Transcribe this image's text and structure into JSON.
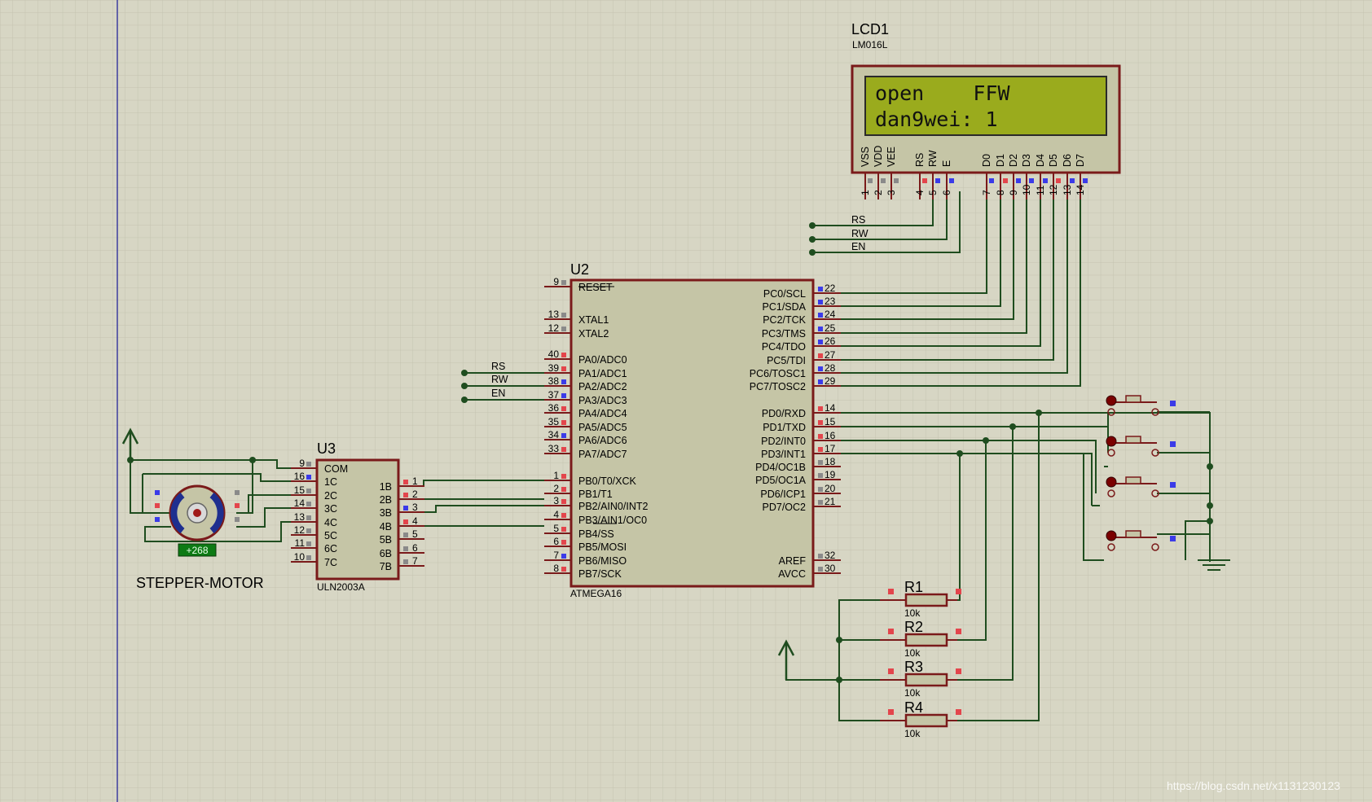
{
  "lcd": {
    "ref": "LCD1",
    "part": "LM016L",
    "line1": "open    FFW",
    "line2": "dan9wei: 1",
    "pin_names": [
      "VSS",
      "VDD",
      "VEE",
      "RS",
      "RW",
      "E",
      "D0",
      "D1",
      "D2",
      "D3",
      "D4",
      "D5",
      "D6",
      "D7"
    ],
    "pin_numbers": [
      "1",
      "2",
      "3",
      "4",
      "5",
      "6",
      "7",
      "8",
      "9",
      "10",
      "11",
      "12",
      "13",
      "14"
    ],
    "net_labels": [
      "RS",
      "RW",
      "EN"
    ]
  },
  "mcu": {
    "ref": "U2",
    "part": "ATMEGA16",
    "left_pins": [
      {
        "num": "9",
        "name": "RESET"
      },
      {
        "num": "13",
        "name": "XTAL1"
      },
      {
        "num": "12",
        "name": "XTAL2"
      },
      {
        "num": "40",
        "name": "PA0/ADC0"
      },
      {
        "num": "39",
        "name": "PA1/ADC1"
      },
      {
        "num": "38",
        "name": "PA2/ADC2"
      },
      {
        "num": "37",
        "name": "PA3/ADC3"
      },
      {
        "num": "36",
        "name": "PA4/ADC4"
      },
      {
        "num": "35",
        "name": "PA5/ADC5"
      },
      {
        "num": "34",
        "name": "PA6/ADC6"
      },
      {
        "num": "33",
        "name": "PA7/ADC7"
      },
      {
        "num": "1",
        "name": "PB0/T0/XCK"
      },
      {
        "num": "2",
        "name": "PB1/T1"
      },
      {
        "num": "3",
        "name": "PB2/AIN0/INT2"
      },
      {
        "num": "4",
        "name": "PB3/AIN1/OC0"
      },
      {
        "num": "5",
        "name": "PB4/SS"
      },
      {
        "num": "6",
        "name": "PB5/MOSI"
      },
      {
        "num": "7",
        "name": "PB6/MISO"
      },
      {
        "num": "8",
        "name": "PB7/SCK"
      }
    ],
    "right_pins": [
      {
        "num": "22",
        "name": "PC0/SCL"
      },
      {
        "num": "23",
        "name": "PC1/SDA"
      },
      {
        "num": "24",
        "name": "PC2/TCK"
      },
      {
        "num": "25",
        "name": "PC3/TMS"
      },
      {
        "num": "26",
        "name": "PC4/TDO"
      },
      {
        "num": "27",
        "name": "PC5/TDI"
      },
      {
        "num": "28",
        "name": "PC6/TOSC1"
      },
      {
        "num": "29",
        "name": "PC7/TOSC2"
      },
      {
        "num": "14",
        "name": "PD0/RXD"
      },
      {
        "num": "15",
        "name": "PD1/TXD"
      },
      {
        "num": "16",
        "name": "PD2/INT0"
      },
      {
        "num": "17",
        "name": "PD3/INT1"
      },
      {
        "num": "18",
        "name": "PD4/OC1B"
      },
      {
        "num": "19",
        "name": "PD5/OC1A"
      },
      {
        "num": "20",
        "name": "PD6/ICP1"
      },
      {
        "num": "21",
        "name": "PD7/OC2"
      },
      {
        "num": "32",
        "name": "AREF"
      },
      {
        "num": "30",
        "name": "AVCC"
      }
    ],
    "net_labels": [
      "RS",
      "RW",
      "EN"
    ]
  },
  "driver": {
    "ref": "U3",
    "part": "ULN2003A",
    "left_pins": [
      {
        "num": "9",
        "name": "COM"
      },
      {
        "num": "16",
        "name": "1C"
      },
      {
        "num": "15",
        "name": "2C"
      },
      {
        "num": "14",
        "name": "3C"
      },
      {
        "num": "13",
        "name": "4C"
      },
      {
        "num": "12",
        "name": "5C"
      },
      {
        "num": "11",
        "name": "6C"
      },
      {
        "num": "10",
        "name": "7C"
      }
    ],
    "right_pins": [
      {
        "num": "1",
        "name": "1B"
      },
      {
        "num": "2",
        "name": "2B"
      },
      {
        "num": "3",
        "name": "3B"
      },
      {
        "num": "4",
        "name": "4B"
      },
      {
        "num": "5",
        "name": "5B"
      },
      {
        "num": "6",
        "name": "6B"
      },
      {
        "num": "7",
        "name": "7B"
      }
    ]
  },
  "motor": {
    "name": "STEPPER-MOTOR",
    "readout": "+268"
  },
  "resistors": [
    {
      "ref": "R1",
      "value": "10k"
    },
    {
      "ref": "R2",
      "value": "10k"
    },
    {
      "ref": "R3",
      "value": "10k"
    },
    {
      "ref": "R4",
      "value": "10k"
    }
  ],
  "watermark": "https://blog.csdn.net/x1131230123",
  "colors": {
    "background": "#d7d6c4",
    "grid": "#c6c5b2",
    "component_border": "#7a1a1a",
    "component_fill": "#c5c5a6",
    "wire": "#1f4d1f",
    "lcd_screen": "#9aab1d",
    "pin_red": "#e3454c",
    "pin_blue": "#3b3be8",
    "pin_gray": "#8a8a8a",
    "margin_line": "#3d3d9e"
  }
}
